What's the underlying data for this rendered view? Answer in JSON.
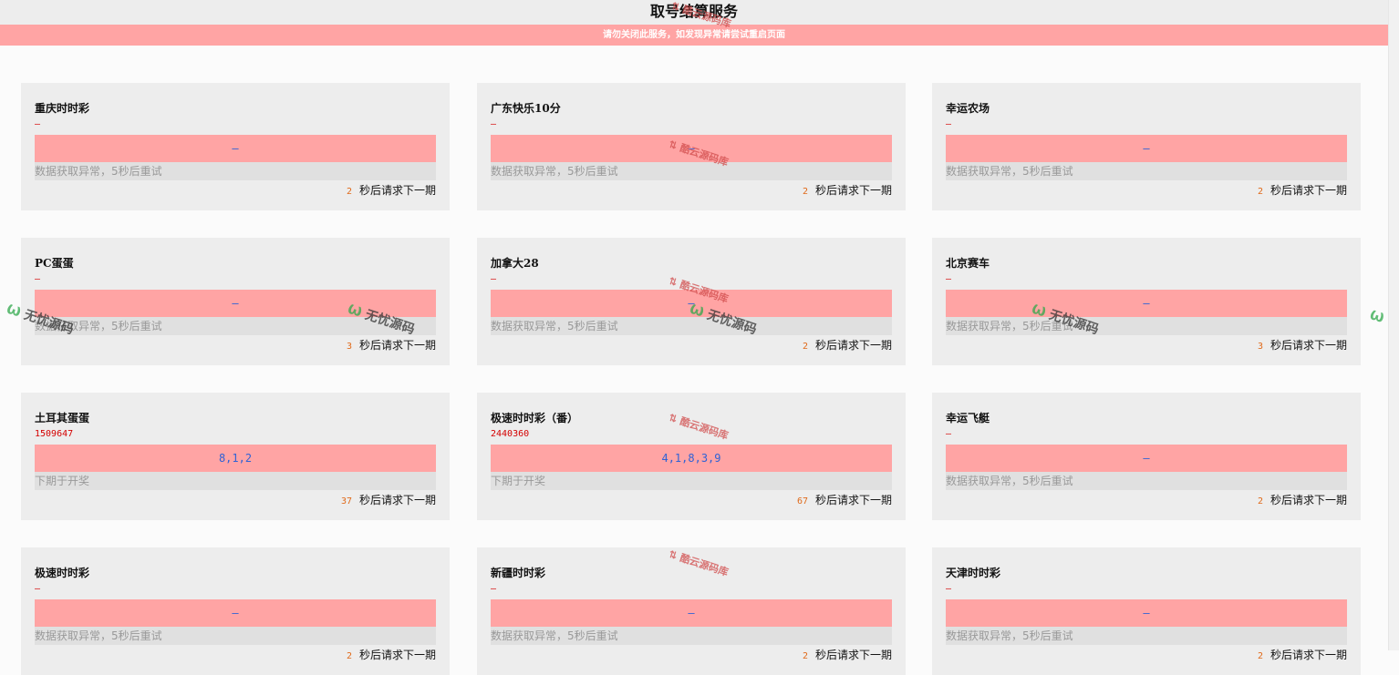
{
  "page": {
    "title": "取号结算服务",
    "notice": "请勿关闭此服务，如发现异常请尝试重启页面",
    "timer_suffix": "秒后请求下一期"
  },
  "cards": [
    {
      "name": "重庆时时彩",
      "issue": "—",
      "result": "—",
      "status": "数据获取异常，5秒后重试",
      "countdown": "2"
    },
    {
      "name": "广东快乐10分",
      "issue": "—",
      "result": "—",
      "status": "数据获取异常，5秒后重试",
      "countdown": "2"
    },
    {
      "name": "幸运农场",
      "issue": "—",
      "result": "—",
      "status": "数据获取异常，5秒后重试",
      "countdown": "2"
    },
    {
      "name": "PC蛋蛋",
      "issue": "—",
      "result": "—",
      "status": "数据获取异常，5秒后重试",
      "countdown": "3"
    },
    {
      "name": "加拿大28",
      "issue": "—",
      "result": "—",
      "status": "数据获取异常，5秒后重试",
      "countdown": "2"
    },
    {
      "name": "北京赛车",
      "issue": "—",
      "result": "—",
      "status": "数据获取异常，5秒后重试",
      "countdown": "3"
    },
    {
      "name": "土耳其蛋蛋",
      "issue": "1509647",
      "result": "8,1,2",
      "status": "下期于开奖",
      "countdown": "37"
    },
    {
      "name": "极速时时彩（番）",
      "issue": "2440360",
      "result": "4,1,8,3,9",
      "status": "下期于开奖",
      "countdown": "67"
    },
    {
      "name": "幸运飞艇",
      "issue": "—",
      "result": "—",
      "status": "数据获取异常，5秒后重试",
      "countdown": "2"
    },
    {
      "name": "极速时时彩",
      "issue": "—",
      "result": "—",
      "status": "数据获取异常，5秒后重试",
      "countdown": "2"
    },
    {
      "name": "新疆时时彩",
      "issue": "—",
      "result": "—",
      "status": "数据获取异常，5秒后重试",
      "countdown": "2"
    },
    {
      "name": "天津时时彩",
      "issue": "—",
      "result": "—",
      "status": "数据获取异常，5秒后重试",
      "countdown": "2"
    }
  ],
  "watermarks": {
    "green_text": "无忧源码",
    "logo_text": "酷云源码库"
  },
  "colors": {
    "accent_pink": "#ffa4a4",
    "result_blue": "#2f62d6",
    "issue_red": "#d40000",
    "countdown_orange": "#e06a1a",
    "card_bg": "#ededed"
  }
}
